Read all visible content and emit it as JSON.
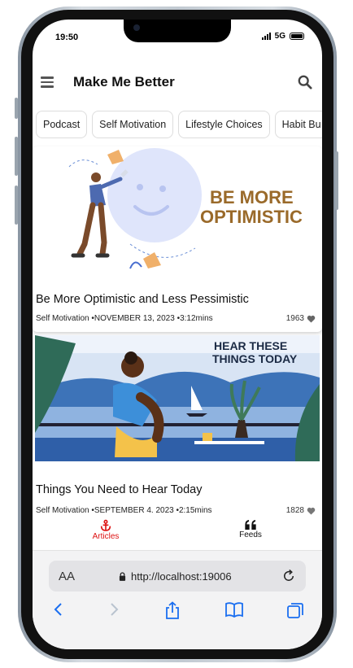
{
  "status": {
    "time": "19:50",
    "network": "5G"
  },
  "header": {
    "title": "Make Me Better"
  },
  "categories": [
    "Podcast",
    "Self Motivation",
    "Lifestyle Choices",
    "Habit Bu"
  ],
  "articles": [
    {
      "image_text": [
        "BE MORE",
        "OPTIMISTIC"
      ],
      "title": "Be More Optimistic and Less Pessimistic",
      "meta": "Self Motivation •NOVEMBER 13, 2023 •3:12mins",
      "likes": "1963"
    },
    {
      "image_text": [
        "HEAR THESE",
        "THINGS TODAY"
      ],
      "title": "Things You Need to Hear Today",
      "meta": "Self Motivation •SEPTEMBER 4. 2023 •2:15mins",
      "likes": "1828"
    }
  ],
  "tabs": [
    {
      "label": "Articles",
      "icon": "anchor-icon",
      "active": true
    },
    {
      "label": "Feeds",
      "icon": "quote-icon",
      "active": false
    }
  ],
  "browser": {
    "text_size_label": "AA",
    "url": "http://localhost:19006"
  },
  "colors": {
    "accent": "#d11111",
    "optimistic_brown": "#9a6a2a"
  }
}
